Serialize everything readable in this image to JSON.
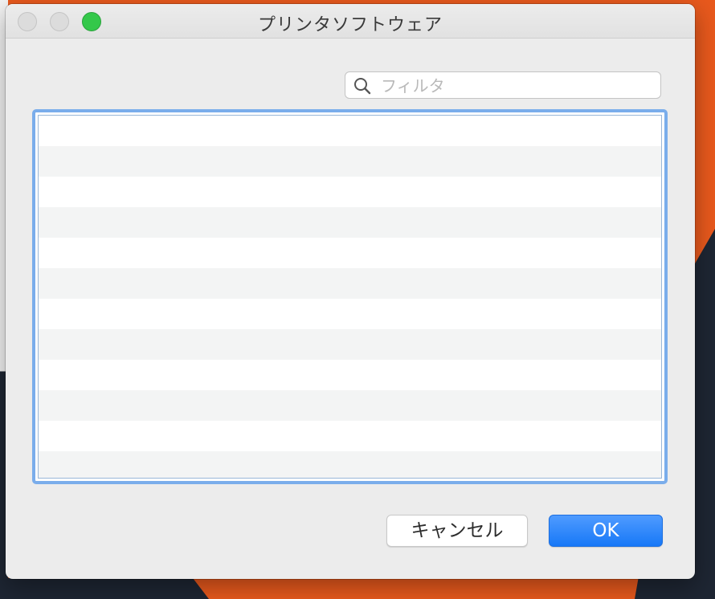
{
  "window": {
    "title": "プリンタソフトウェア"
  },
  "search": {
    "placeholder": "フィルタ",
    "value": ""
  },
  "list": {
    "items": []
  },
  "buttons": {
    "cancel_label": "キャンセル",
    "ok_label": "OK"
  },
  "colors": {
    "desktop_background": "#e8591d",
    "window_background": "#ececec",
    "list_focus_ring": "#7aadeb",
    "list_row_alt": "#f3f4f4",
    "ok_button": "#1778f7",
    "zoom_button": "#34c84a"
  }
}
